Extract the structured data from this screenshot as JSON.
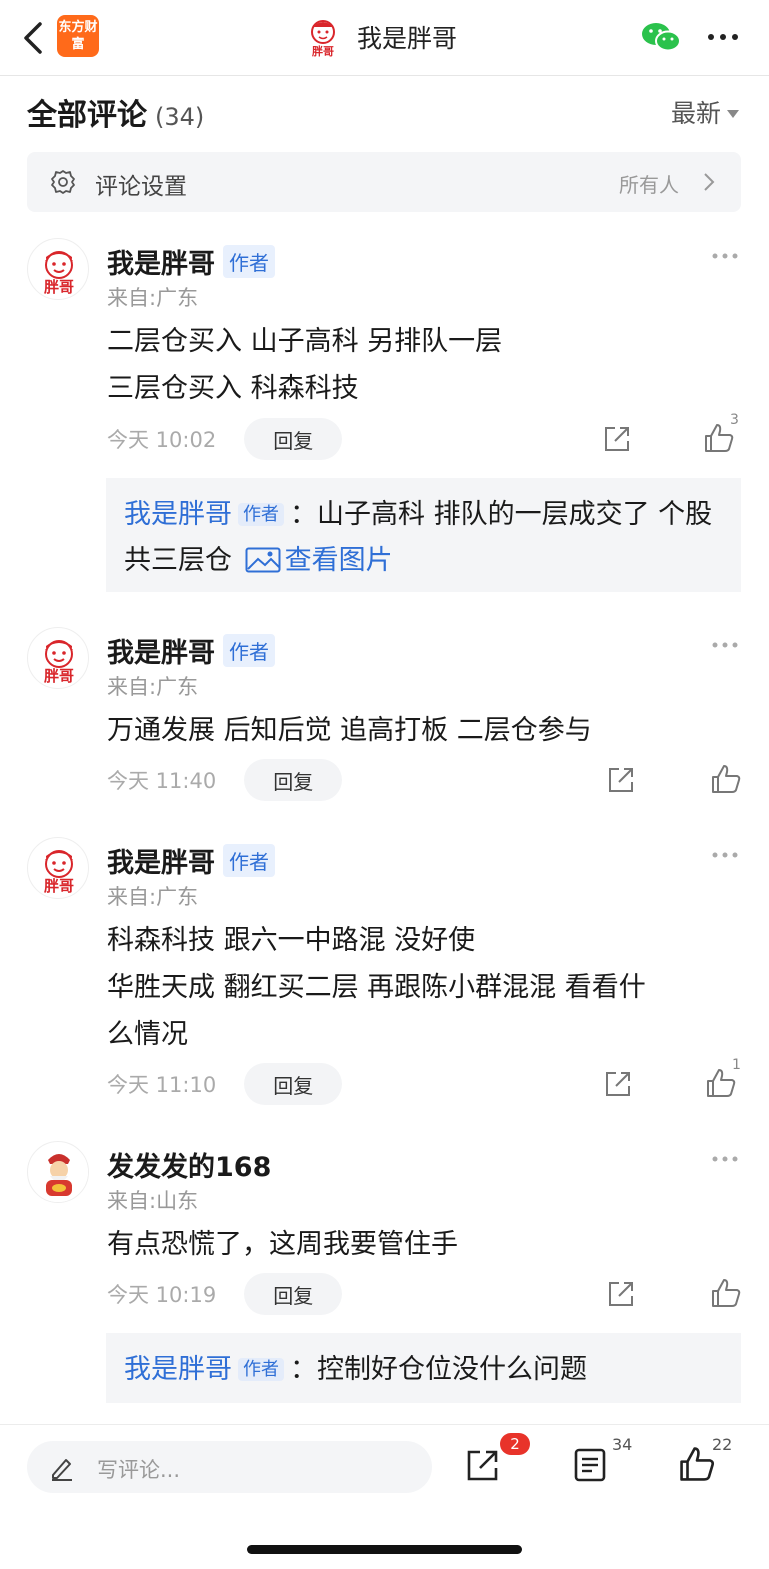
{
  "nav": {
    "app_logo_text": "东方财富",
    "title": "我是胖哥",
    "avatar_text": "胖哥"
  },
  "header": {
    "title": "全部评论",
    "count": "(34)",
    "sort_label": "最新"
  },
  "settings": {
    "label": "评论设置",
    "value": "所有人"
  },
  "comments": [
    {
      "author": "我是胖哥",
      "author_tag": "作者",
      "location": "来自:广东",
      "lines": [
        "二层仓买入 山子高科 另排队一层",
        "三层仓买入 科森科技"
      ],
      "time": "今天 10:02",
      "reply_label": "回复",
      "like_count": "3",
      "reply": {
        "author": "我是胖哥",
        "author_tag": "作者",
        "text": "：山子高科 排队的一层成交了 个股共三层仓",
        "image_link": "查看图片"
      }
    },
    {
      "author": "我是胖哥",
      "author_tag": "作者",
      "location": "来自:广东",
      "lines": [
        "万通发展 后知后觉 追高打板 二层仓参与"
      ],
      "time": "今天 11:40",
      "reply_label": "回复",
      "like_count": ""
    },
    {
      "author": "我是胖哥",
      "author_tag": "作者",
      "location": "来自:广东",
      "lines": [
        "科森科技 跟六一中路混 没好使",
        "华胜天成 翻红买二层 再跟陈小群混混 看看什",
        "么情况"
      ],
      "time": "今天 11:10",
      "reply_label": "回复",
      "like_count": "1"
    },
    {
      "author": "发发发的168",
      "location": "来自:山东",
      "lines": [
        "有点恐慌了，这周我要管住手"
      ],
      "time": "今天 10:19",
      "reply_label": "回复",
      "like_count": "",
      "reply": {
        "author": "我是胖哥",
        "author_tag": "作者",
        "text": "：控制好仓位没什么问题"
      }
    }
  ],
  "bottom_bar": {
    "placeholder": "写评论...",
    "share_badge": "2",
    "comment_count": "34",
    "like_count": "22"
  },
  "colors": {
    "accent_blue": "#2f6fd6",
    "brand_orange": "#ff6a1a",
    "badge_red": "#e8332a",
    "wechat_green": "#2bc24c"
  }
}
